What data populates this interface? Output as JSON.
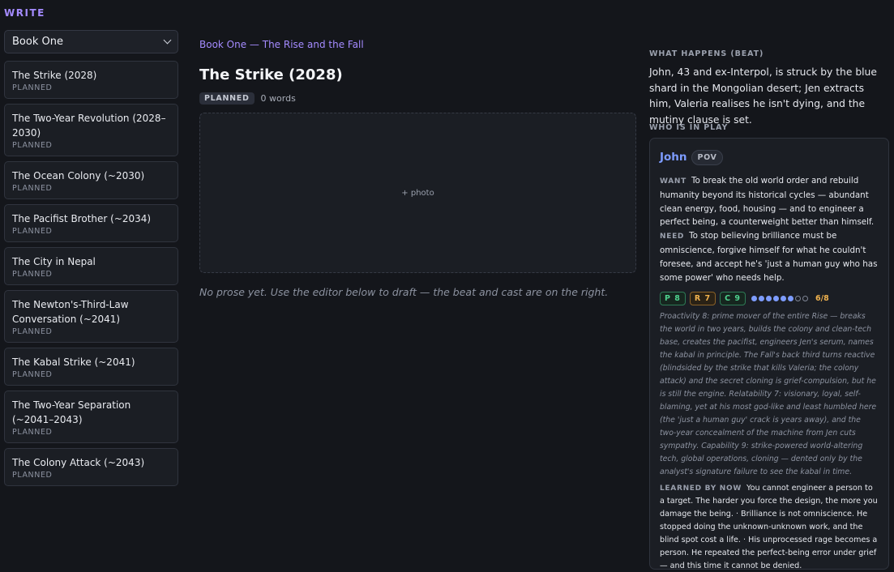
{
  "sidebar": {
    "section_label": "WRITE",
    "book_select": {
      "value": "Book One"
    },
    "beats": [
      {
        "title": "The Strike (2028)",
        "status": "PLANNED"
      },
      {
        "title": "The Two-Year Revolution (2028–2030)",
        "status": "PLANNED"
      },
      {
        "title": "The Ocean Colony (~2030)",
        "status": "PLANNED"
      },
      {
        "title": "The Pacifist Brother (~2034)",
        "status": "PLANNED"
      },
      {
        "title": "The City in Nepal",
        "status": "PLANNED"
      },
      {
        "title": "The Newton's-Third-Law Conversation (~2041)",
        "status": "PLANNED"
      },
      {
        "title": "The Kabal Strike (~2041)",
        "status": "PLANNED"
      },
      {
        "title": "The Two-Year Separation (~2041–2043)",
        "status": "PLANNED"
      },
      {
        "title": "The Colony Attack (~2043)",
        "status": "PLANNED"
      }
    ]
  },
  "main": {
    "breadcrumb": "Book One — The Rise and the Fall",
    "title": "The Strike (2028)",
    "status": "PLANNED",
    "word_count": "0 words",
    "photo_label": "+ photo",
    "empty_note": "No prose yet. Use the editor below to draft — the beat and cast are on the right."
  },
  "beat_panel": {
    "label": "WHAT HAPPENS (BEAT)",
    "text": "John, 43 and ex-Interpol, is struck by the blue shard in the Mongolian desert; Jen extracts him, Valeria realises he isn't dying, and the mutiny clause is set."
  },
  "cast_panel": {
    "label": "WHO IS IN PLAY",
    "character": {
      "name": "John",
      "pov_label": "POV",
      "want_label": "WANT",
      "want": "To break the old world order and rebuild humanity beyond its historical cycles — abundant clean energy, food, housing — and to engineer a perfect being, a counterweight better than himself.",
      "need_label": "NEED",
      "need": "To stop believing brilliance must be omniscience, forgive himself for what he couldn't foresee, and accept he's 'just a human guy who has some power' who needs help.",
      "stats": {
        "p": "P 8",
        "r": "R 7",
        "c": "C 9"
      },
      "dots_filled": 6,
      "dots_total": 8,
      "score": "6/8",
      "analysis": "Proactivity 8: prime mover of the entire Rise — breaks the world in two years, builds the colony and clean-tech base, creates the pacifist, engineers Jen's serum, names the kabal in principle. The Fall's back third turns reactive (blindsided by the strike that kills Valeria; the colony attack) and the secret cloning is grief-compulsion, but he is still the engine. Relatability 7: visionary, loyal, self-blaming, yet at his most god-like and least humbled here (the 'just a human guy' crack is years away), and the two-year concealment of the machine from Jen cuts sympathy. Capability 9: strike-powered world-altering tech, global operations, cloning — dented only by the analyst's signature failure to see the kabal in time.",
      "learned_label": "LEARNED BY NOW",
      "learned": "You cannot engineer a person to a target. The harder you force the design, the more you damage the being. · Brilliance is not omniscience. He stopped doing the unknown-unknown work, and the blind spot cost a life. · His unprocessed rage becomes a person. He repeated the perfect-being error under grief — and this time it cannot be denied."
    }
  }
}
